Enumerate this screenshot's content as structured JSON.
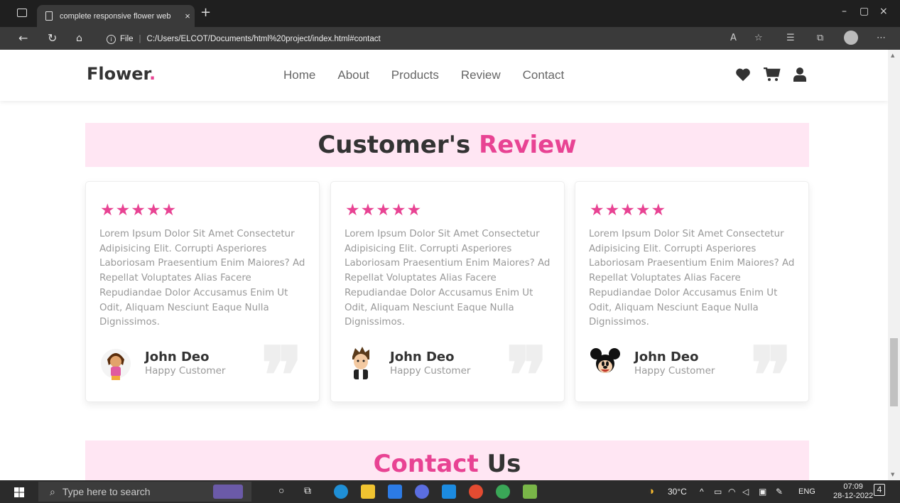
{
  "browser": {
    "tab_title": "complete responsive flower web",
    "tab_close": "×",
    "new_tab": "+",
    "url_label": "File",
    "url": "C:/Users/ELCOT/Documents/html%20project/index.html#contact",
    "window_controls": [
      "–",
      "▢",
      "×"
    ]
  },
  "site": {
    "logo": "Flower",
    "logo_dot": ".",
    "nav": [
      "Home",
      "About",
      "Products",
      "Review",
      "Contact"
    ],
    "icons": [
      "heart-icon",
      "cart-icon",
      "user-icon"
    ]
  },
  "review_section": {
    "title_dark": "Customer's",
    "title_pink": "Review",
    "cards": [
      {
        "stars": "★★★★★",
        "text": "Lorem Ipsum Dolor Sit Amet Consectetur Adipisicing Elit. Corrupti Asperiores Laboriosam Praesentium Enim Maiores? Ad Repellat Voluptates Alias Facere Repudiandae Dolor Accusamus Enim Ut Odit, Aliquam Nesciunt Eaque Nulla Dignissimos.",
        "name": "John Deo",
        "role": "Happy Customer",
        "quote": "❞"
      },
      {
        "stars": "★★★★★",
        "text": "Lorem Ipsum Dolor Sit Amet Consectetur Adipisicing Elit. Corrupti Asperiores Laboriosam Praesentium Enim Maiores? Ad Repellat Voluptates Alias Facere Repudiandae Dolor Accusamus Enim Ut Odit, Aliquam Nesciunt Eaque Nulla Dignissimos.",
        "name": "John Deo",
        "role": "Happy Customer",
        "quote": "❞"
      },
      {
        "stars": "★★★★★",
        "text": "Lorem Ipsum Dolor Sit Amet Consectetur Adipisicing Elit. Corrupti Asperiores Laboriosam Praesentium Enim Maiores? Ad Repellat Voluptates Alias Facere Repudiandae Dolor Accusamus Enim Ut Odit, Aliquam Nesciunt Eaque Nulla Dignissimos.",
        "name": "John Deo",
        "role": "Happy Customer",
        "quote": "❞"
      }
    ]
  },
  "contact_section": {
    "title_pink": "Contact",
    "title_dark": "Us"
  },
  "taskbar": {
    "search_placeholder": "Type here to search",
    "weather": "30°C",
    "language": "ENG",
    "time": "07:09",
    "date": "28-12-2022",
    "notification_count": "4"
  },
  "colors": {
    "accent": "#e84393",
    "title_bg": "#ffe6f3"
  }
}
